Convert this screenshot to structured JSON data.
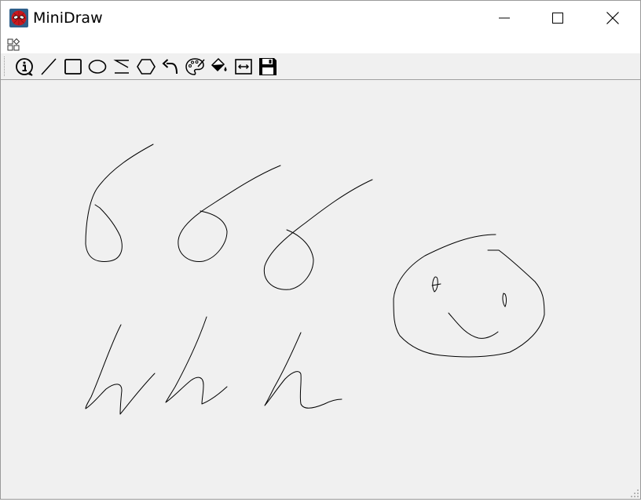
{
  "window": {
    "title": "MiniDraw",
    "controls": {
      "minimize": "minimize-icon",
      "maximize": "maximize-icon",
      "close": "close-icon"
    }
  },
  "menubar": {
    "icon": "apps-menu-icon"
  },
  "toolbar": {
    "tools": [
      "info-icon",
      "line-icon",
      "rectangle-icon",
      "ellipse-icon",
      "freehand-icon",
      "polygon-icon",
      "undo-icon",
      "palette-icon",
      "fill-icon",
      "width-icon",
      "save-icon"
    ]
  },
  "canvas": {
    "stroke_color": "#000000",
    "background_color": "#f0f0f0"
  },
  "colors": {
    "titlebar": "#ffffff",
    "window_background": "#f0f0f0"
  }
}
